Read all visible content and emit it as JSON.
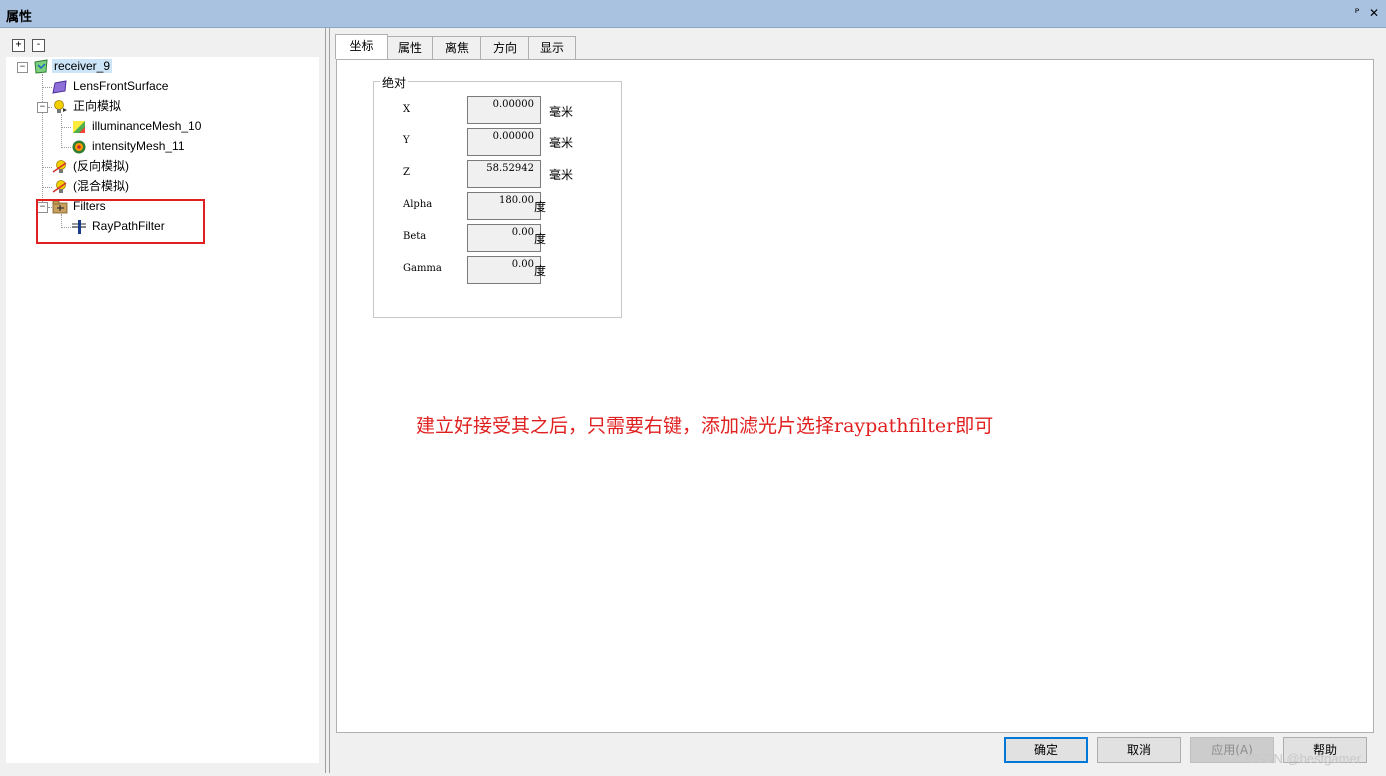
{
  "window": {
    "title": "属性",
    "pin_glyph": "ᴾ",
    "close_glyph": "✕"
  },
  "tree_controls": {
    "expand_label": "+",
    "collapse_label": "-"
  },
  "tree": {
    "root": "receiver_9",
    "lens": "LensFrontSurface",
    "forward_sim": "正向模拟",
    "illum_mesh": "illuminanceMesh_10",
    "intensity_mesh": "intensityMesh_11",
    "reverse_sim": "(反向模拟)",
    "hybrid_sim": "(混合模拟)",
    "filters": "Filters",
    "raypath": "RayPathFilter"
  },
  "tabs": [
    "坐标",
    "属性",
    "离焦",
    "方向",
    "显示"
  ],
  "group": {
    "title": "绝对",
    "fields": [
      {
        "label": "X",
        "value": "0.00000",
        "unit": "毫米"
      },
      {
        "label": "Y",
        "value": "0.00000",
        "unit": "毫米"
      },
      {
        "label": "Z",
        "value": "58.52942",
        "unit": "毫米"
      },
      {
        "label": "Alpha",
        "value": "180.00",
        "unit": "度"
      },
      {
        "label": "Beta",
        "value": "0.00",
        "unit": "度"
      },
      {
        "label": "Gamma",
        "value": "0.00",
        "unit": "度"
      }
    ]
  },
  "annotation": "建立好接受其之后，只需要右键，添加滤光片选择raypathfilter即可",
  "buttons": {
    "ok": "确定",
    "cancel": "取消",
    "apply": "应用(A)",
    "help": "帮助"
  },
  "watermark": "CSDN @bestgamer",
  "colors": {
    "title_bar": "#a9c2e0",
    "annotation": "#e02020",
    "highlight_box": "#e02020"
  }
}
